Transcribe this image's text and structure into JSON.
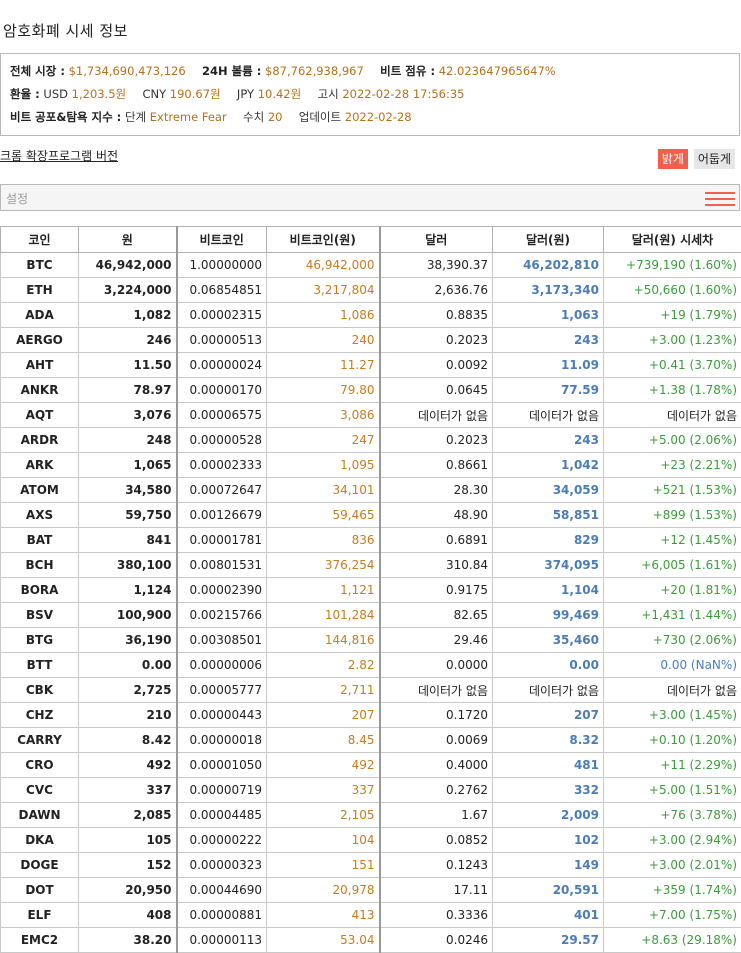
{
  "page_title": "암호화폐 시세 정보",
  "summary": {
    "total_market_label": "전체 시장 :",
    "total_market_value": "$1,734,690,473,126",
    "volume_label": "24H 볼륨 :",
    "volume_value": "$87,762,938,967",
    "dominance_label": "비트 점유 :",
    "dominance_value": "42.023647965647%",
    "fx_label": "환율 :",
    "usd_label": "USD",
    "usd_value": "1,203.5원",
    "cny_label": "CNY",
    "cny_value": "190.67원",
    "jpy_label": "JPY",
    "jpy_value": "10.42원",
    "notice_label": "고시",
    "notice_value": "2022-02-28 17:56:35",
    "fear_label": "비트 공포&탐욕 지수 :",
    "stage_label": "단계",
    "stage_value": "Extreme Fear",
    "score_label": "수치",
    "score_value": "20",
    "update_label": "업데이트",
    "update_value": "2022-02-28"
  },
  "extension_link": "크롬 확장프로그램 버전",
  "theme": {
    "light_label": "밝게",
    "dark_label": "어둡게",
    "light_color": "#f0604a"
  },
  "settings_label": "설정",
  "table": {
    "headers": [
      "코인",
      "원",
      "비트코인",
      "비트코인(원)",
      "달러",
      "달러(원)",
      "달러(원) 시세차"
    ],
    "rows": [
      [
        "BTC",
        "46,942,000",
        "1.00000000",
        "46,942,000",
        "38,390.37",
        "46,202,810",
        "+739,190 (1.60%)"
      ],
      [
        "ETH",
        "3,224,000",
        "0.06854851",
        "3,217,804",
        "2,636.76",
        "3,173,340",
        "+50,660 (1.60%)"
      ],
      [
        "ADA",
        "1,082",
        "0.00002315",
        "1,086",
        "0.8835",
        "1,063",
        "+19 (1.79%)"
      ],
      [
        "AERGO",
        "246",
        "0.00000513",
        "240",
        "0.2023",
        "243",
        "+3.00 (1.23%)"
      ],
      [
        "AHT",
        "11.50",
        "0.00000024",
        "11.27",
        "0.0092",
        "11.09",
        "+0.41 (3.70%)"
      ],
      [
        "ANKR",
        "78.97",
        "0.00000170",
        "79.80",
        "0.0645",
        "77.59",
        "+1.38 (1.78%)"
      ],
      [
        "AQT",
        "3,076",
        "0.00006575",
        "3,086",
        "데이터가 없음",
        "데이터가 없음",
        "데이터가 없음"
      ],
      [
        "ARDR",
        "248",
        "0.00000528",
        "247",
        "0.2023",
        "243",
        "+5.00 (2.06%)"
      ],
      [
        "ARK",
        "1,065",
        "0.00002333",
        "1,095",
        "0.8661",
        "1,042",
        "+23 (2.21%)"
      ],
      [
        "ATOM",
        "34,580",
        "0.00072647",
        "34,101",
        "28.30",
        "34,059",
        "+521 (1.53%)"
      ],
      [
        "AXS",
        "59,750",
        "0.00126679",
        "59,465",
        "48.90",
        "58,851",
        "+899 (1.53%)"
      ],
      [
        "BAT",
        "841",
        "0.00001781",
        "836",
        "0.6891",
        "829",
        "+12 (1.45%)"
      ],
      [
        "BCH",
        "380,100",
        "0.00801531",
        "376,254",
        "310.84",
        "374,095",
        "+6,005 (1.61%)"
      ],
      [
        "BORA",
        "1,124",
        "0.00002390",
        "1,121",
        "0.9175",
        "1,104",
        "+20 (1.81%)"
      ],
      [
        "BSV",
        "100,900",
        "0.00215766",
        "101,284",
        "82.65",
        "99,469",
        "+1,431 (1.44%)"
      ],
      [
        "BTG",
        "36,190",
        "0.00308501",
        "144,816",
        "29.46",
        "35,460",
        "+730 (2.06%)"
      ],
      [
        "BTT",
        "0.00",
        "0.00000006",
        "2.82",
        "0.0000",
        "0.00",
        "0.00 (NaN%)"
      ],
      [
        "CBK",
        "2,725",
        "0.00005777",
        "2,711",
        "데이터가 없음",
        "데이터가 없음",
        "데이터가 없음"
      ],
      [
        "CHZ",
        "210",
        "0.00000443",
        "207",
        "0.1720",
        "207",
        "+3.00 (1.45%)"
      ],
      [
        "CARRY",
        "8.42",
        "0.00000018",
        "8.45",
        "0.0069",
        "8.32",
        "+0.10 (1.20%)"
      ],
      [
        "CRO",
        "492",
        "0.00001050",
        "492",
        "0.4000",
        "481",
        "+11 (2.29%)"
      ],
      [
        "CVC",
        "337",
        "0.00000719",
        "337",
        "0.2762",
        "332",
        "+5.00 (1.51%)"
      ],
      [
        "DAWN",
        "2,085",
        "0.00004485",
        "2,105",
        "1.67",
        "2,009",
        "+76 (3.78%)"
      ],
      [
        "DKA",
        "105",
        "0.00000222",
        "104",
        "0.0852",
        "102",
        "+3.00 (2.94%)"
      ],
      [
        "DOGE",
        "152",
        "0.00000323",
        "151",
        "0.1243",
        "149",
        "+3.00 (2.01%)"
      ],
      [
        "DOT",
        "20,950",
        "0.00044690",
        "20,978",
        "17.11",
        "20,591",
        "+359 (1.74%)"
      ],
      [
        "ELF",
        "408",
        "0.00000881",
        "413",
        "0.3336",
        "401",
        "+7.00 (1.75%)"
      ],
      [
        "EMC2",
        "38.20",
        "0.00000113",
        "53.04",
        "0.0246",
        "29.57",
        "+8.63 (29.18%)"
      ]
    ]
  }
}
